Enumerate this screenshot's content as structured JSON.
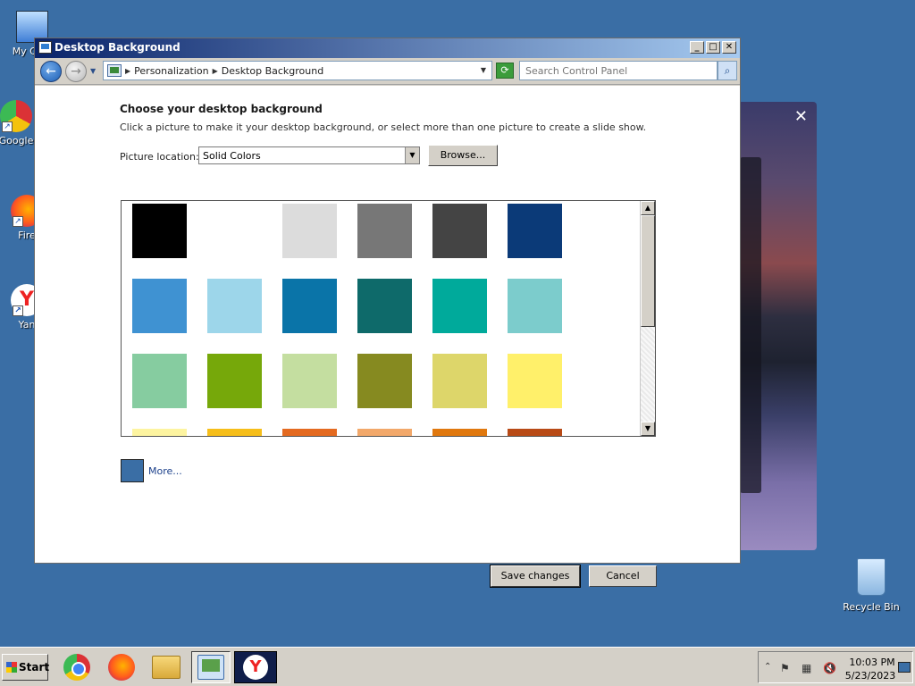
{
  "desktop": {
    "icons": [
      {
        "label": "My Com",
        "icon": "computer-icon"
      },
      {
        "label": "Google",
        "icon": "chrome-icon"
      },
      {
        "label": "Fire",
        "icon": "firefox-icon"
      },
      {
        "label": "Yan",
        "icon": "yandex-icon"
      }
    ],
    "recycle_bin": "Recycle Bin"
  },
  "photo_window": {
    "close_glyph": "✕"
  },
  "window": {
    "title": "Desktop Background",
    "controls": {
      "minimize": "_",
      "maximize": "□",
      "close": "✕"
    },
    "address": {
      "crumbs": [
        "Personalization",
        "Desktop Background"
      ],
      "search_placeholder": "Search Control Panel"
    },
    "heading": "Choose your desktop background",
    "subtext": "Click a picture to make it your desktop background, or select more than one picture to create a slide show.",
    "location_label": "Picture location:",
    "location_value": "Solid Colors",
    "browse_label": "Browse...",
    "swatches": [
      "#000000",
      "#ffffff",
      "#dcdcdc",
      "#777777",
      "#444444",
      "#0b3a78",
      "#3f92d2",
      "#9dd6ea",
      "#0a74a8",
      "#0e6a6a",
      "#00aa9b",
      "#7ccccc",
      "#86cca0",
      "#76a80a",
      "#c4dea0",
      "#868a20",
      "#ddd66a",
      "#fff06a",
      "#fdf4a0",
      "#f6be1a",
      "#e46a20",
      "#f2a86a",
      "#e0780e",
      "#b84a16"
    ],
    "more_label": "More...",
    "more_color": "#3a6ea5",
    "save_label": "Save changes",
    "cancel_label": "Cancel"
  },
  "taskbar": {
    "start_label": "Start",
    "time": "10:03 PM",
    "date": "5/23/2023"
  }
}
